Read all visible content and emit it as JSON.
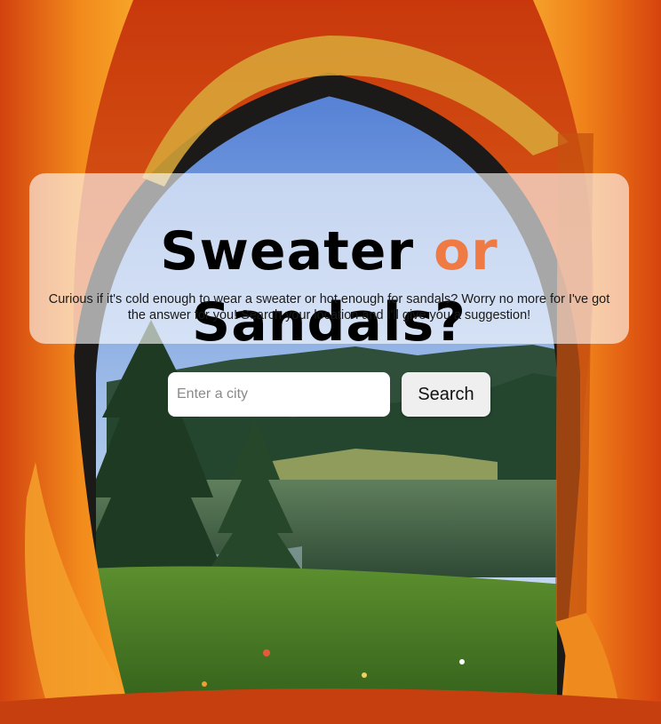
{
  "header": {
    "title_part1": "Sweater ",
    "title_accent": "or",
    "title_part2": " Sandals?",
    "subtitle": "Curious if it's cold enough to wear a sweater or hot enough for sandals? Worry no more for I've got the answer for you! Search your location and I'll give you a suggestion!"
  },
  "search": {
    "placeholder": "Enter a city",
    "value": "",
    "button_label": "Search"
  },
  "colors": {
    "accent": "#f07a44",
    "tent_orange": "#e8581a",
    "card_background": "rgba(255,255,255,0.62)"
  }
}
